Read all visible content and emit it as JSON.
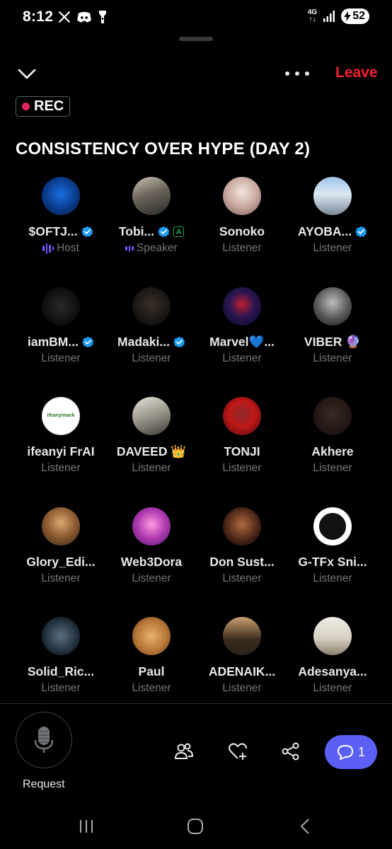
{
  "status_bar": {
    "time": "8:12",
    "network_label": "4G",
    "network_sub": "↑↓",
    "battery": "52"
  },
  "header": {
    "leave_label": "Leave",
    "rec_label": "REC"
  },
  "space": {
    "title": "CONSISTENCY OVER HYPE (DAY 2)"
  },
  "participants": [
    {
      "name": "$OFTJ...",
      "role": "Host",
      "verified": true,
      "speaking": true
    },
    {
      "name": "Tobi...",
      "role": "Speaker",
      "verified": true,
      "badge": "A",
      "speaking": true
    },
    {
      "name": "Sonoko",
      "role": "Listener"
    },
    {
      "name": "AYOBA...",
      "role": "Listener",
      "verified": true
    },
    {
      "name": "iamBM...",
      "role": "Listener",
      "verified": true
    },
    {
      "name": "Madaki...",
      "role": "Listener",
      "verified": true
    },
    {
      "name": "Marvel💙...",
      "role": "Listener"
    },
    {
      "name": "VIBER 🔮",
      "role": "Listener"
    },
    {
      "name": "ifeanyi FrAI",
      "role": "Listener",
      "avatar_text": "ifeanyimark"
    },
    {
      "name": "DAVEED 👑",
      "role": "Listener"
    },
    {
      "name": "TONJI",
      "role": "Listener"
    },
    {
      "name": "Akhere",
      "role": "Listener"
    },
    {
      "name": "Glory_Edi...",
      "role": "Listener"
    },
    {
      "name": "Web3Dora",
      "role": "Listener"
    },
    {
      "name": "Don Sust...",
      "role": "Listener"
    },
    {
      "name": "G-TFx Sni...",
      "role": "Listener"
    },
    {
      "name": "Solid_Ric...",
      "role": "Listener"
    },
    {
      "name": "Paul",
      "role": "Listener"
    },
    {
      "name": "ADENAIK...",
      "role": "Listener"
    },
    {
      "name": "Adesanya...",
      "role": "Listener"
    }
  ],
  "bottom_bar": {
    "request_label": "Request",
    "chat_count": "1"
  },
  "colors": {
    "accent_purple": "#7856ff",
    "leave_red": "#f4212e",
    "verified_blue": "#1d9bf0",
    "chat_button": "#5b5ff5",
    "rec_dot": "#e0245e"
  }
}
